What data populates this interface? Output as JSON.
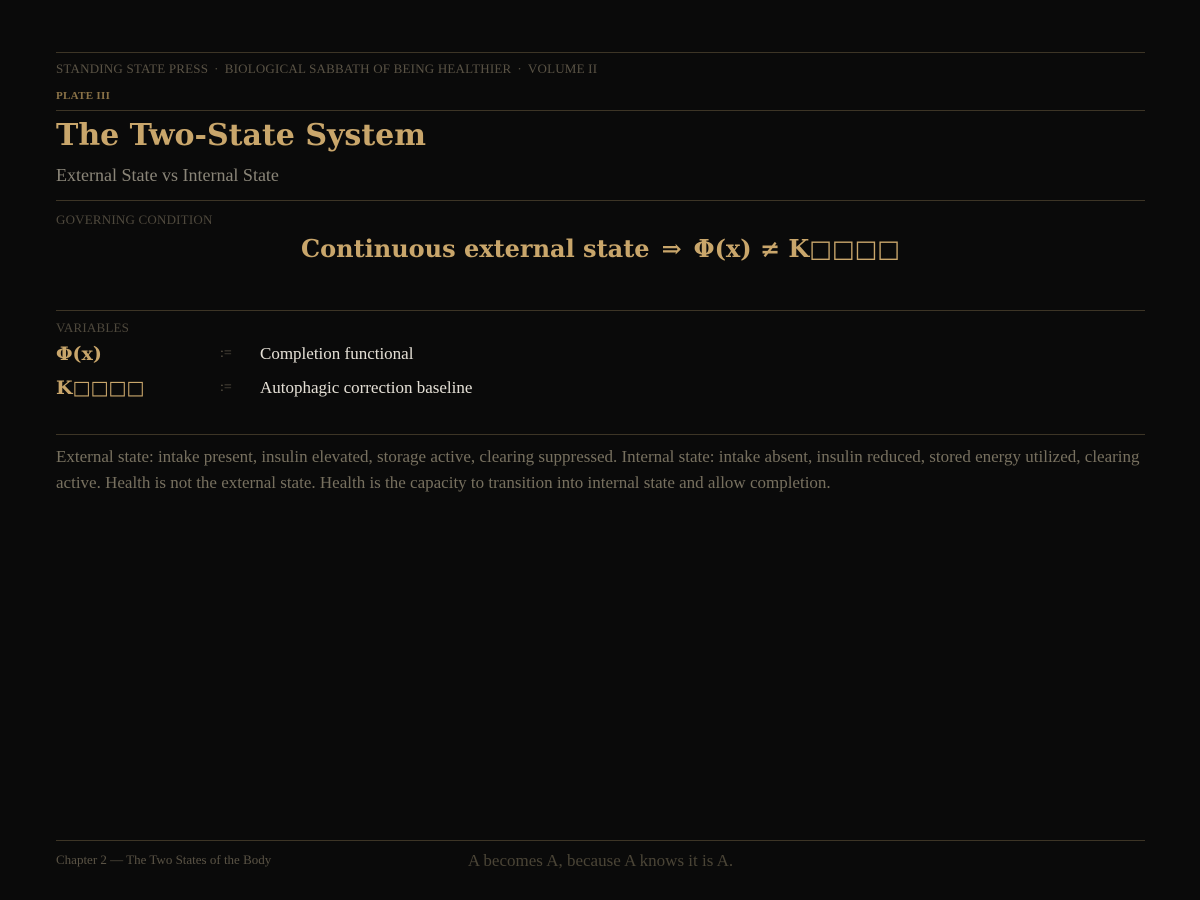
{
  "header": {
    "publisher": "STANDING STATE PRESS",
    "series": "BIOLOGICAL SABBATH OF BEING HEALTHIER",
    "volume": "VOLUME II",
    "separator": "·",
    "plate": "PLATE III"
  },
  "title": "The Two-State System",
  "subtitle": "External State vs Internal State",
  "governing": {
    "label": "GOVERNING CONDITION",
    "lhs": "Continuous external state",
    "arrow": "⇒",
    "rhs": "Φ(x) ≠ K□□□□"
  },
  "variables": {
    "label": "VARIABLES",
    "items": [
      {
        "symbol": "Φ(x)",
        "assign": ":=",
        "desc": "Completion functional"
      },
      {
        "symbol": "K□□□□",
        "assign": ":=",
        "desc": "Autophagic correction baseline"
      }
    ]
  },
  "body": "External state: intake present, insulin elevated, storage active, clearing suppressed. Internal state: intake absent, insulin reduced, stored energy utilized, clearing active. Health is not the external state. Health is the capacity to transition into internal state and allow completion.",
  "footer": {
    "chapter": "Chapter 2 — The Two States of the Body",
    "motto": "A becomes A, because A knows it is A."
  }
}
